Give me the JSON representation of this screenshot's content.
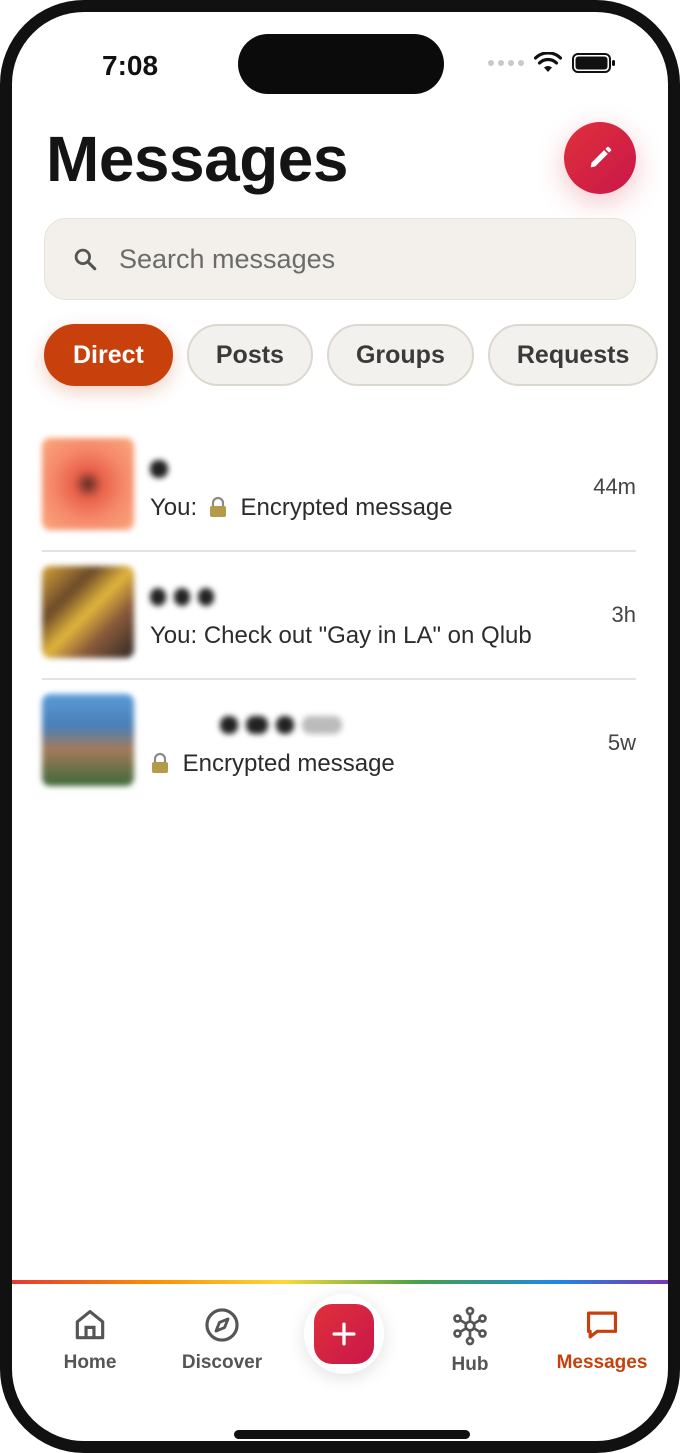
{
  "status_bar": {
    "time": "7:08"
  },
  "header": {
    "title": "Messages",
    "compose_icon": "pencil-icon"
  },
  "search": {
    "placeholder": "Search messages"
  },
  "tabs": [
    {
      "label": "Direct",
      "active": true
    },
    {
      "label": "Posts",
      "active": false
    },
    {
      "label": "Groups",
      "active": false
    },
    {
      "label": "Requests",
      "active": false
    }
  ],
  "conversations": [
    {
      "preview_prefix": "You:",
      "preview_text": "Encrypted message",
      "encrypted": true,
      "time": "44m"
    },
    {
      "preview_prefix": "You:",
      "preview_text": "Check out \"Gay in LA\" on Qlub",
      "encrypted": false,
      "time": "3h"
    },
    {
      "preview_prefix": "",
      "preview_text": "Encrypted message",
      "encrypted": true,
      "time": "5w"
    }
  ],
  "bottom_nav": {
    "items": [
      {
        "label": "Home",
        "icon": "home-icon",
        "active": false
      },
      {
        "label": "Discover",
        "icon": "compass-icon",
        "active": false
      },
      {
        "label": "Hub",
        "icon": "hub-icon",
        "active": false
      },
      {
        "label": "Messages",
        "icon": "chat-icon",
        "active": true
      }
    ],
    "create_icon": "plus-icon"
  },
  "colors": {
    "accent": "#c8400b",
    "brand_red": "#d62a3e"
  }
}
